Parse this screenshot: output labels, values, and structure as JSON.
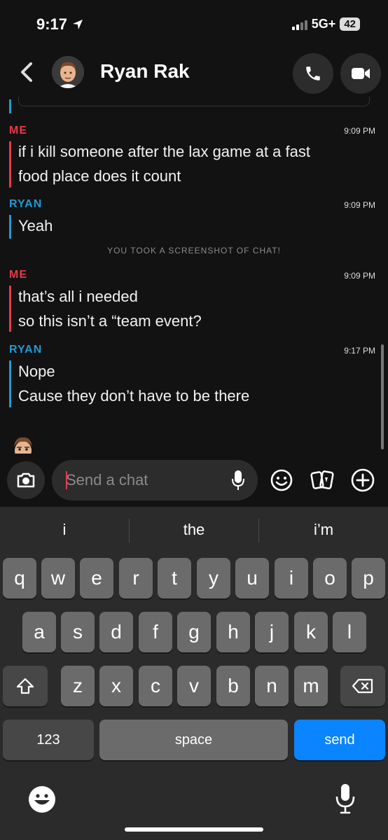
{
  "status": {
    "time": "9:17",
    "network": "5G+",
    "battery": "42"
  },
  "header": {
    "contact_name": "Ryan Rak"
  },
  "messages": [
    {
      "sender": "ME",
      "time": "9:09 PM",
      "lines": [
        "if i kill someone after the lax game at a fast",
        "food place does it count"
      ]
    },
    {
      "sender": "RYAN",
      "time": "9:09 PM",
      "lines": [
        "Yeah"
      ]
    },
    {
      "sender": "ME",
      "time": "9:09 PM",
      "lines": [
        "that’s all i needed",
        "so this isn’t a “team event?"
      ]
    },
    {
      "sender": "RYAN",
      "time": "9:17 PM",
      "lines": [
        "Nope",
        "Cause they don’t have to be there"
      ]
    }
  ],
  "notice": "YOU TOOK A SCREENSHOT OF CHAT!",
  "composer": {
    "placeholder": "Send a chat"
  },
  "keyboard": {
    "suggestions": [
      "i",
      "the",
      "i’m"
    ],
    "row1": [
      "q",
      "w",
      "e",
      "r",
      "t",
      "y",
      "u",
      "i",
      "o",
      "p"
    ],
    "row2": [
      "a",
      "s",
      "d",
      "f",
      "g",
      "h",
      "j",
      "k",
      "l"
    ],
    "row3": [
      "z",
      "x",
      "c",
      "v",
      "b",
      "n",
      "m"
    ],
    "numbers_label": "123",
    "space_label": "space",
    "send_label": "send"
  },
  "colors": {
    "me": "#e8394a",
    "ryan": "#1e9bd7",
    "send": "#0a84ff"
  }
}
